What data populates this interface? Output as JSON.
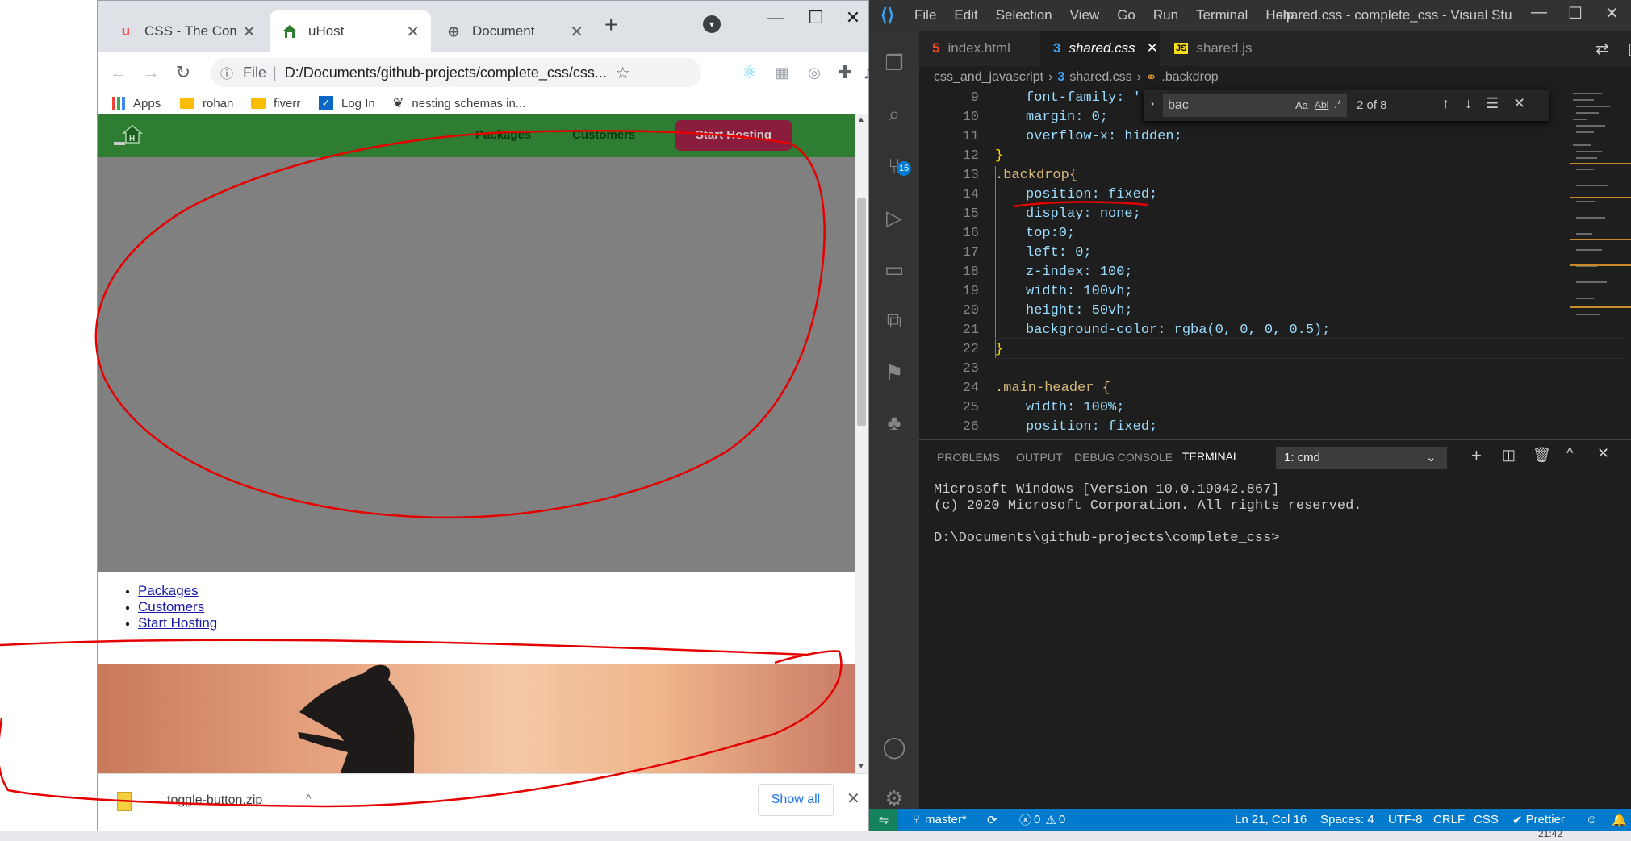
{
  "browser": {
    "tabs": [
      {
        "title": "CSS - The Complete",
        "icon": "udemy-icon"
      },
      {
        "title": "uHost",
        "icon": "uhost-icon"
      },
      {
        "title": "Document",
        "icon": "globe-icon"
      }
    ],
    "address": {
      "scheme": "File",
      "url": "D:/Documents/github-projects/complete_css/css..."
    },
    "bookmarks": [
      "Apps",
      "rohan",
      "fiverr",
      "Log In",
      "nesting schemas in..."
    ],
    "page": {
      "nav": [
        "Packages",
        "Customers",
        "Start Hosting"
      ],
      "list": [
        "Packages",
        "Customers",
        "Start Hosting"
      ]
    },
    "download": {
      "file": "toggle-button.zip",
      "show_all": "Show all"
    }
  },
  "vscode": {
    "menu": [
      "File",
      "Edit",
      "Selection",
      "View",
      "Go",
      "Run",
      "Terminal",
      "Help"
    ],
    "title": "shared.css - complete_css - Visual Studio...",
    "scm_badge": "15",
    "tabs": [
      "index.html",
      "shared.css",
      "shared.js"
    ],
    "breadcrumb": [
      "css_and_javascript",
      "shared.css",
      ".backdrop"
    ],
    "find": {
      "query": "bac",
      "count": "2 of 8",
      "opt_case": "Aa",
      "opt_word": "Abl",
      "opt_regex": ".*"
    },
    "code_lines": [
      {
        "n": "9",
        "text": "font-family: '"
      },
      {
        "n": "10",
        "text": "margin: 0;"
      },
      {
        "n": "11",
        "text": "overflow-x: hidden;"
      },
      {
        "n": "12",
        "text": "}"
      },
      {
        "n": "13",
        "text": ".backdrop{"
      },
      {
        "n": "14",
        "text": "position: fixed;"
      },
      {
        "n": "15",
        "text": "display: none;"
      },
      {
        "n": "16",
        "text": "top:0;"
      },
      {
        "n": "17",
        "text": "left: 0;"
      },
      {
        "n": "18",
        "text": "z-index: 100;"
      },
      {
        "n": "19",
        "text": "width: 100vh;"
      },
      {
        "n": "20",
        "text": "height: 50vh;"
      },
      {
        "n": "21",
        "text": "background-color: rgba(0, 0, 0, 0.5);"
      },
      {
        "n": "22",
        "text": "}"
      },
      {
        "n": "23",
        "text": ""
      },
      {
        "n": "24",
        "text": ".main-header {"
      },
      {
        "n": "25",
        "text": "width: 100%;"
      },
      {
        "n": "26",
        "text": "position: fixed;"
      }
    ],
    "panel_tabs": [
      "PROBLEMS",
      "OUTPUT",
      "DEBUG CONSOLE",
      "TERMINAL"
    ],
    "terminal_select": "1: cmd",
    "terminal_lines": [
      "Microsoft Windows [Version 10.0.19042.867]",
      "(c) 2020 Microsoft Corporation. All rights reserved.",
      "",
      "D:\\Documents\\github-projects\\complete_css>"
    ],
    "status": {
      "branch": "master*",
      "errors": "0",
      "warnings": "0",
      "position": "Ln 21, Col 16",
      "spaces": "Spaces: 4",
      "encoding": "UTF-8",
      "eol": "CRLF",
      "language": "CSS",
      "formatter": "Prettier"
    },
    "colors": {
      "statusbar": "#007acc",
      "editor": "#1e1e1e",
      "activity": "#333333"
    }
  },
  "taskbar": {
    "clock": "21:42"
  }
}
